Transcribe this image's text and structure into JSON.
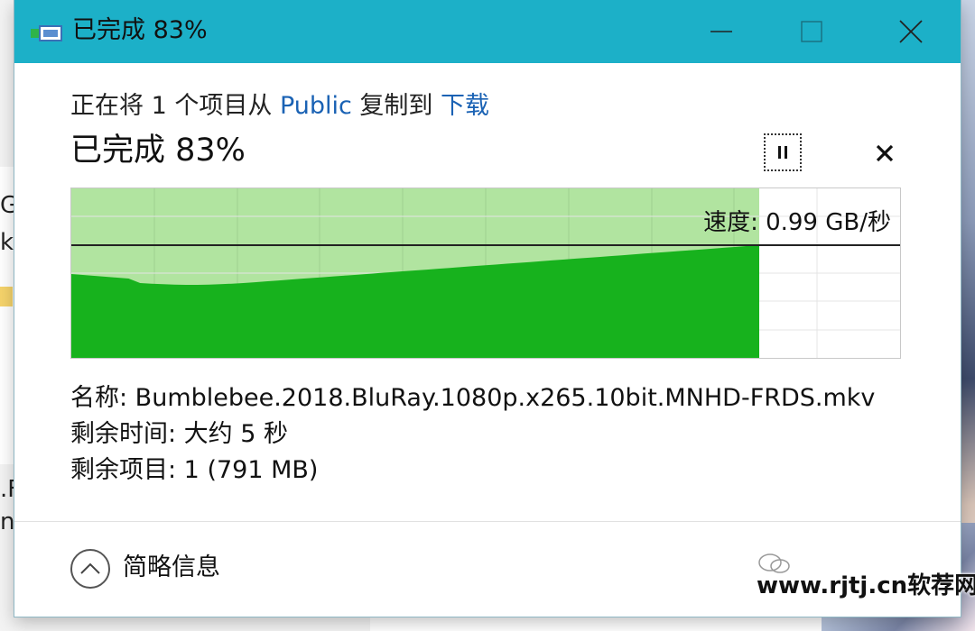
{
  "window": {
    "title": "已完成 83%"
  },
  "copy": {
    "prefix": "正在将 1 个项目从 ",
    "source": "Public",
    "middle": " 复制到 ",
    "destination": "下载",
    "progress_title": "已完成 83%",
    "percent_complete": 83
  },
  "graph": {
    "speed_text": "速度: 0.99 GB/秒"
  },
  "details": {
    "name": "名称:  Bumblebee.2018.BluRay.1080p.x265.10bit.MNHD-FRDS.mkv",
    "time_remaining": "剩余时间:  大约 5 秒",
    "items_remaining": "剩余项目:  1 (791 MB)"
  },
  "footer": {
    "less_details_label": "简略信息"
  },
  "watermark": {
    "text": "www.rjtj.cn软荐网"
  },
  "colors": {
    "titlebar": "#1cb0c8",
    "progress_fill": "#b1e4a0",
    "speed_fill": "#17b21d",
    "link": "#1a62b4"
  },
  "icons": {
    "title": "file-copy-icon",
    "pause": "pause-icon",
    "cancel": "close-icon",
    "collapse": "chevron-up-icon"
  }
}
